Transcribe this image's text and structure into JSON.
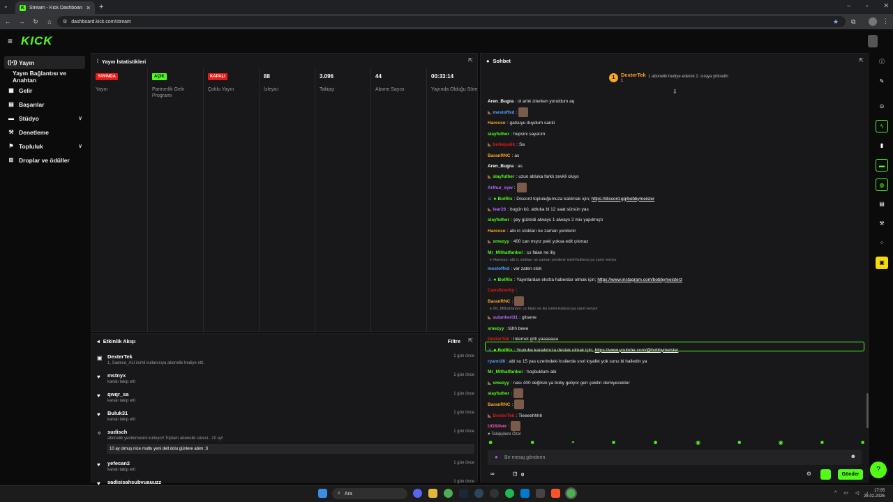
{
  "browser": {
    "tab_title": "Stream - Kick Dashboard",
    "url": "dashboard.kick.com/stream"
  },
  "brand": {
    "logo": "KICK",
    "accent": "#53fc18"
  },
  "sidebar": {
    "items": [
      {
        "label": "Yayın",
        "icon": "broadcast-icon"
      },
      {
        "label": "Yayın Bağlantısı ve Anahtarı",
        "icon": ""
      },
      {
        "label": "Gelir",
        "icon": "revenue-icon"
      },
      {
        "label": "Başarılar",
        "icon": "achievements-icon"
      },
      {
        "label": "Stüdyo",
        "icon": "studio-icon"
      },
      {
        "label": "Denetleme",
        "icon": "moderation-icon"
      },
      {
        "label": "Topluluk",
        "icon": "community-icon"
      },
      {
        "label": "Droplar ve ödüller",
        "icon": "drops-icon"
      }
    ]
  },
  "stats": {
    "title": "Yayın İstatistikleri",
    "cols": [
      {
        "badge": "YAYINDA",
        "badge_color": "#e91916",
        "label": "Yayın"
      },
      {
        "badge": "AÇIK",
        "badge_color": "#53fc18",
        "label": "Partnerlik Gelir Programı"
      },
      {
        "badge": "KAPALI",
        "badge_color": "#e91916",
        "label": "Çoklu Yayın"
      },
      {
        "value": "88",
        "label": "İzleyici"
      },
      {
        "value": "3.096",
        "label": "Takipçi"
      },
      {
        "value": "44",
        "label": "Abone Sayısı"
      },
      {
        "value": "00:33:14",
        "label": "Yayında Olduğu Süre"
      }
    ]
  },
  "events": {
    "title": "Etkinlik Akışı",
    "filter": "Filtre",
    "items": [
      {
        "icon": "gift-icon",
        "name": "DexterTek",
        "desc": "1, Sadece_ALİ isimli kullanıcıya abonelik hediye etti.",
        "time": "1 gün önce"
      },
      {
        "icon": "heart-icon",
        "name": "mstnyx",
        "desc": "kanalı takip etti",
        "time": "1 gün önce"
      },
      {
        "icon": "heart-icon",
        "name": "qwqr_sa",
        "desc": "kanalı takip etti",
        "time": "1 gün önce"
      },
      {
        "icon": "heart-icon",
        "name": "Buluk31",
        "desc": "kanalı takip etti",
        "time": "1 gün önce"
      },
      {
        "icon": "star-icon",
        "name": "sudisch",
        "desc": "abonelik yenilemesini kutluyor! Toplam abonelik süresi - 10 ay!",
        "time": "1 gün önce",
        "box": "10 ay olmuş nice mutlu yeni dell dolu günlere abim :3"
      },
      {
        "icon": "heart-icon",
        "name": "yefecan2",
        "desc": "kanalı takip etti",
        "time": "1 gün önce"
      },
      {
        "icon": "heart-icon",
        "name": "sadisisahsubvuauuzz",
        "desc": "",
        "time": "1 gün önce"
      }
    ]
  },
  "chat": {
    "title": "Sohbet",
    "pinned": {
      "name": "DexterTek",
      "count": "1",
      "gift_text": "1 abonelik hediye ederek 2. sıraya yükselin"
    },
    "messages": [
      {
        "user": "Aren_Bugra",
        "color": "#ffffff",
        "text": "ol artık izlerken yoruldum aq"
      },
      {
        "user": "mestoffxd",
        "color": "#5aa0ff",
        "text": "",
        "emote": true
      },
      {
        "user": "Haresso",
        "color": "#f5a623",
        "text": "gatsuyu duydum sanki"
      },
      {
        "user": "slayfuther",
        "color": "#53fc18",
        "text": "hepsini sayarım"
      },
      {
        "user": "berkayalik",
        "color": "#e91916",
        "text": "Sa"
      },
      {
        "user": "BaranRNC",
        "color": "#f5a623",
        "text": "as"
      },
      {
        "user": "Aren_Bugra",
        "color": "#ffffff",
        "text": "as"
      },
      {
        "user": "slayfuther",
        "color": "#53fc18",
        "text": "uzun abluka farklı zevkli oluyo"
      },
      {
        "user": "Arthur_eyw",
        "color": "#b36bff",
        "text": "",
        "emote": true
      },
      {
        "user": "BotRix",
        "color": "#53fc18",
        "text": "Discord topluluğumuza katılmak için; ",
        "link": "https://discord.gg/bobbymeister"
      },
      {
        "user": "lear26",
        "color": "#b36bff",
        "text": "bugün kü. abluka bi 12 saat sürsün yas"
      },
      {
        "user": "slayfuther",
        "color": "#53fc18",
        "text": "şey güzeldi always 1 always 2 mix yapılmıştı"
      },
      {
        "user": "Haresso",
        "color": "#f5a623",
        "text": "abi rc stokları ne zaman yenilenir"
      },
      {
        "user": "xmezyy",
        "color": "#53fc18",
        "text": "400 can mıyız peki yoksa edit çıkmaz"
      },
      {
        "user": "Mr_Mithatfanboi",
        "color": "#53fc18",
        "text": "cs falan ne iliş"
      },
      {
        "user": "mestoffxd",
        "color": "#5aa0ff",
        "text": "var zaten stok",
        "reply": "Haresso: abi rc stokları ne zaman yenilenir isimli kullanıcıya yanıt veriyor"
      },
      {
        "user": "BotRix",
        "color": "#53fc18",
        "text": "Yayınlardan ekstra haberdar olmak için; ",
        "link": "https://www.instagram.com/bobbymeisterz"
      },
      {
        "user": "CansBoerby",
        "color": "#e91916",
        "text": "",
        "emote": false
      },
      {
        "user": "BaranRNC",
        "color": "#f5a623",
        "text": "",
        "emote": true
      },
      {
        "user": "sulankeri31",
        "color": "#b36bff",
        "text": "gitsene",
        "reply": "Mr_Mithatfanboi: cs falan ne iliş isimli kullanıcıya yanıt veriyor"
      },
      {
        "user": "xmezyy",
        "color": "#53fc18",
        "text": "tühh beee"
      },
      {
        "user": "DexterTek",
        "color": "#e91916",
        "text": "Internet gitti yaaaaaaa"
      },
      {
        "user": "BotRix",
        "color": "#53fc18",
        "text": "Youtube kanalımıza destek olmak için; ",
        "link": "https://www.youtube.com/@bobbymeister"
      },
      {
        "user": "ryann38",
        "color": "#5aa0ff",
        "text": "abi su 15 yas uzerindeki kısilerde sıvıl kıyafet yok sunu bi halledin ya"
      },
      {
        "user": "Mr_Mithatfanboi",
        "color": "#53fc18",
        "text": "hoşbuldum abi"
      },
      {
        "user": "xmezyy",
        "color": "#53fc18",
        "text": "nası 400 değilsin ya boby geliyor geri çekilin demiyecekler"
      },
      {
        "user": "slayfuther",
        "color": "#53fc18",
        "text": "",
        "emote": true
      },
      {
        "user": "BaranRNC",
        "color": "#f5a623",
        "text": "",
        "emote": true
      },
      {
        "user": "DexterTek",
        "color": "#e91916",
        "text": "Tieeeehhhh"
      },
      {
        "user": "UGSilver",
        "color": "#ff5ab4",
        "text": "",
        "emote": true
      }
    ],
    "followers_only": "Takipçilere Özel",
    "input_placeholder": "Bir mesaj gönderin",
    "zero": "0",
    "send": "Gönder"
  },
  "taskbar": {
    "search": "Ara",
    "time": "17:05",
    "date": "28.02.2026"
  }
}
